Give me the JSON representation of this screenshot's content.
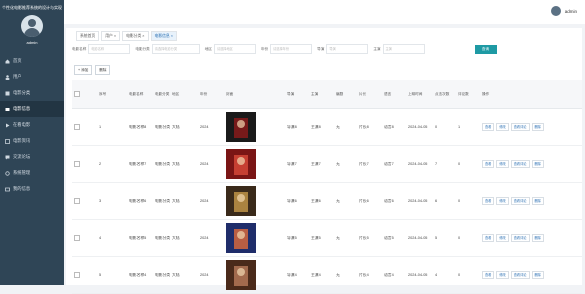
{
  "app": {
    "title": "个性化电影推荐系统的设计与实现",
    "user": "admin"
  },
  "topbar": {
    "user": "admin"
  },
  "sidebar": {
    "items": [
      {
        "label": "首页",
        "icon": "home-icon",
        "active": false
      },
      {
        "label": "用户",
        "icon": "user-icon",
        "active": false
      },
      {
        "label": "电影分类",
        "icon": "category-icon",
        "active": false
      },
      {
        "label": "电影信息",
        "icon": "film-icon",
        "active": true
      },
      {
        "label": "在看电影",
        "icon": "play-icon",
        "active": false
      },
      {
        "label": "电影资讯",
        "icon": "news-icon",
        "active": false
      },
      {
        "label": "交流论坛",
        "icon": "forum-icon",
        "active": false
      },
      {
        "label": "系统管理",
        "icon": "settings-icon",
        "active": false
      },
      {
        "label": "我的信息",
        "icon": "profile-icon",
        "active": false
      }
    ]
  },
  "tabs": [
    {
      "label": "系统首页",
      "active": false
    },
    {
      "label": "用户 ×",
      "active": false
    },
    {
      "label": "电影分类 ×",
      "active": false
    },
    {
      "label": "电影信息 ×",
      "active": true
    }
  ],
  "filters": [
    {
      "label": "电影名称",
      "placeholder": "电影名称"
    },
    {
      "label": "电影分类",
      "placeholder": "请选择电影分类"
    },
    {
      "label": "地区",
      "placeholder": "请选择地区"
    },
    {
      "label": "年份",
      "placeholder": "请选择年份"
    },
    {
      "label": "导演",
      "placeholder": "导演"
    },
    {
      "label": "主演",
      "placeholder": "主演"
    }
  ],
  "search_button": "查询",
  "actions": {
    "add": "+ 添加",
    "delete": "删除"
  },
  "columns": [
    "序号",
    "电影名称",
    "电影分类",
    "地区",
    "年份",
    "封面",
    "导演",
    "主演",
    "编剧",
    "片长",
    "语言",
    "上映时间",
    "点击次数",
    "评论数",
    "操作"
  ],
  "rows": [
    {
      "no": "1",
      "name": "电影名称8",
      "category": "电影分类8",
      "region": "大陆",
      "year": "2024",
      "director": "导演8",
      "actor": "主演8",
      "writer": "无",
      "length": "片长8",
      "language": "语言8",
      "release": "2024-04-05",
      "clicks": "0",
      "comments": "1"
    },
    {
      "no": "2",
      "name": "电影名称7",
      "category": "电影分类7",
      "region": "大陆",
      "year": "2024",
      "director": "导演7",
      "actor": "主演7",
      "writer": "无",
      "length": "片长7",
      "language": "语言7",
      "release": "2024-04-05",
      "clicks": "7",
      "comments": "0"
    },
    {
      "no": "3",
      "name": "电影名称6",
      "category": "电影分类6",
      "region": "大陆",
      "year": "2024",
      "director": "导演6",
      "actor": "主演6",
      "writer": "无",
      "length": "片长6",
      "language": "语言6",
      "release": "2024-04-05",
      "clicks": "6",
      "comments": "0"
    },
    {
      "no": "4",
      "name": "电影名称5",
      "category": "电影分类5",
      "region": "大陆",
      "year": "2024",
      "director": "导演5",
      "actor": "主演5",
      "writer": "无",
      "length": "片长5",
      "language": "语言5",
      "release": "2024-04-05",
      "clicks": "5",
      "comments": "0"
    },
    {
      "no": "5",
      "name": "电影名称4",
      "category": "电影分类4",
      "region": "大陆",
      "year": "2024",
      "director": "导演4",
      "actor": "主演4",
      "writer": "无",
      "length": "片长4",
      "language": "语言4",
      "release": "2024-04-05",
      "clicks": "4",
      "comments": "0"
    }
  ],
  "row_ops": {
    "view": "查看",
    "edit": "修改",
    "view_comments": "查看评论",
    "delete": "删除"
  },
  "colors": {
    "sidebar": "#2f4556",
    "accent": "#1e9aa4",
    "link": "#2a6fb3"
  }
}
